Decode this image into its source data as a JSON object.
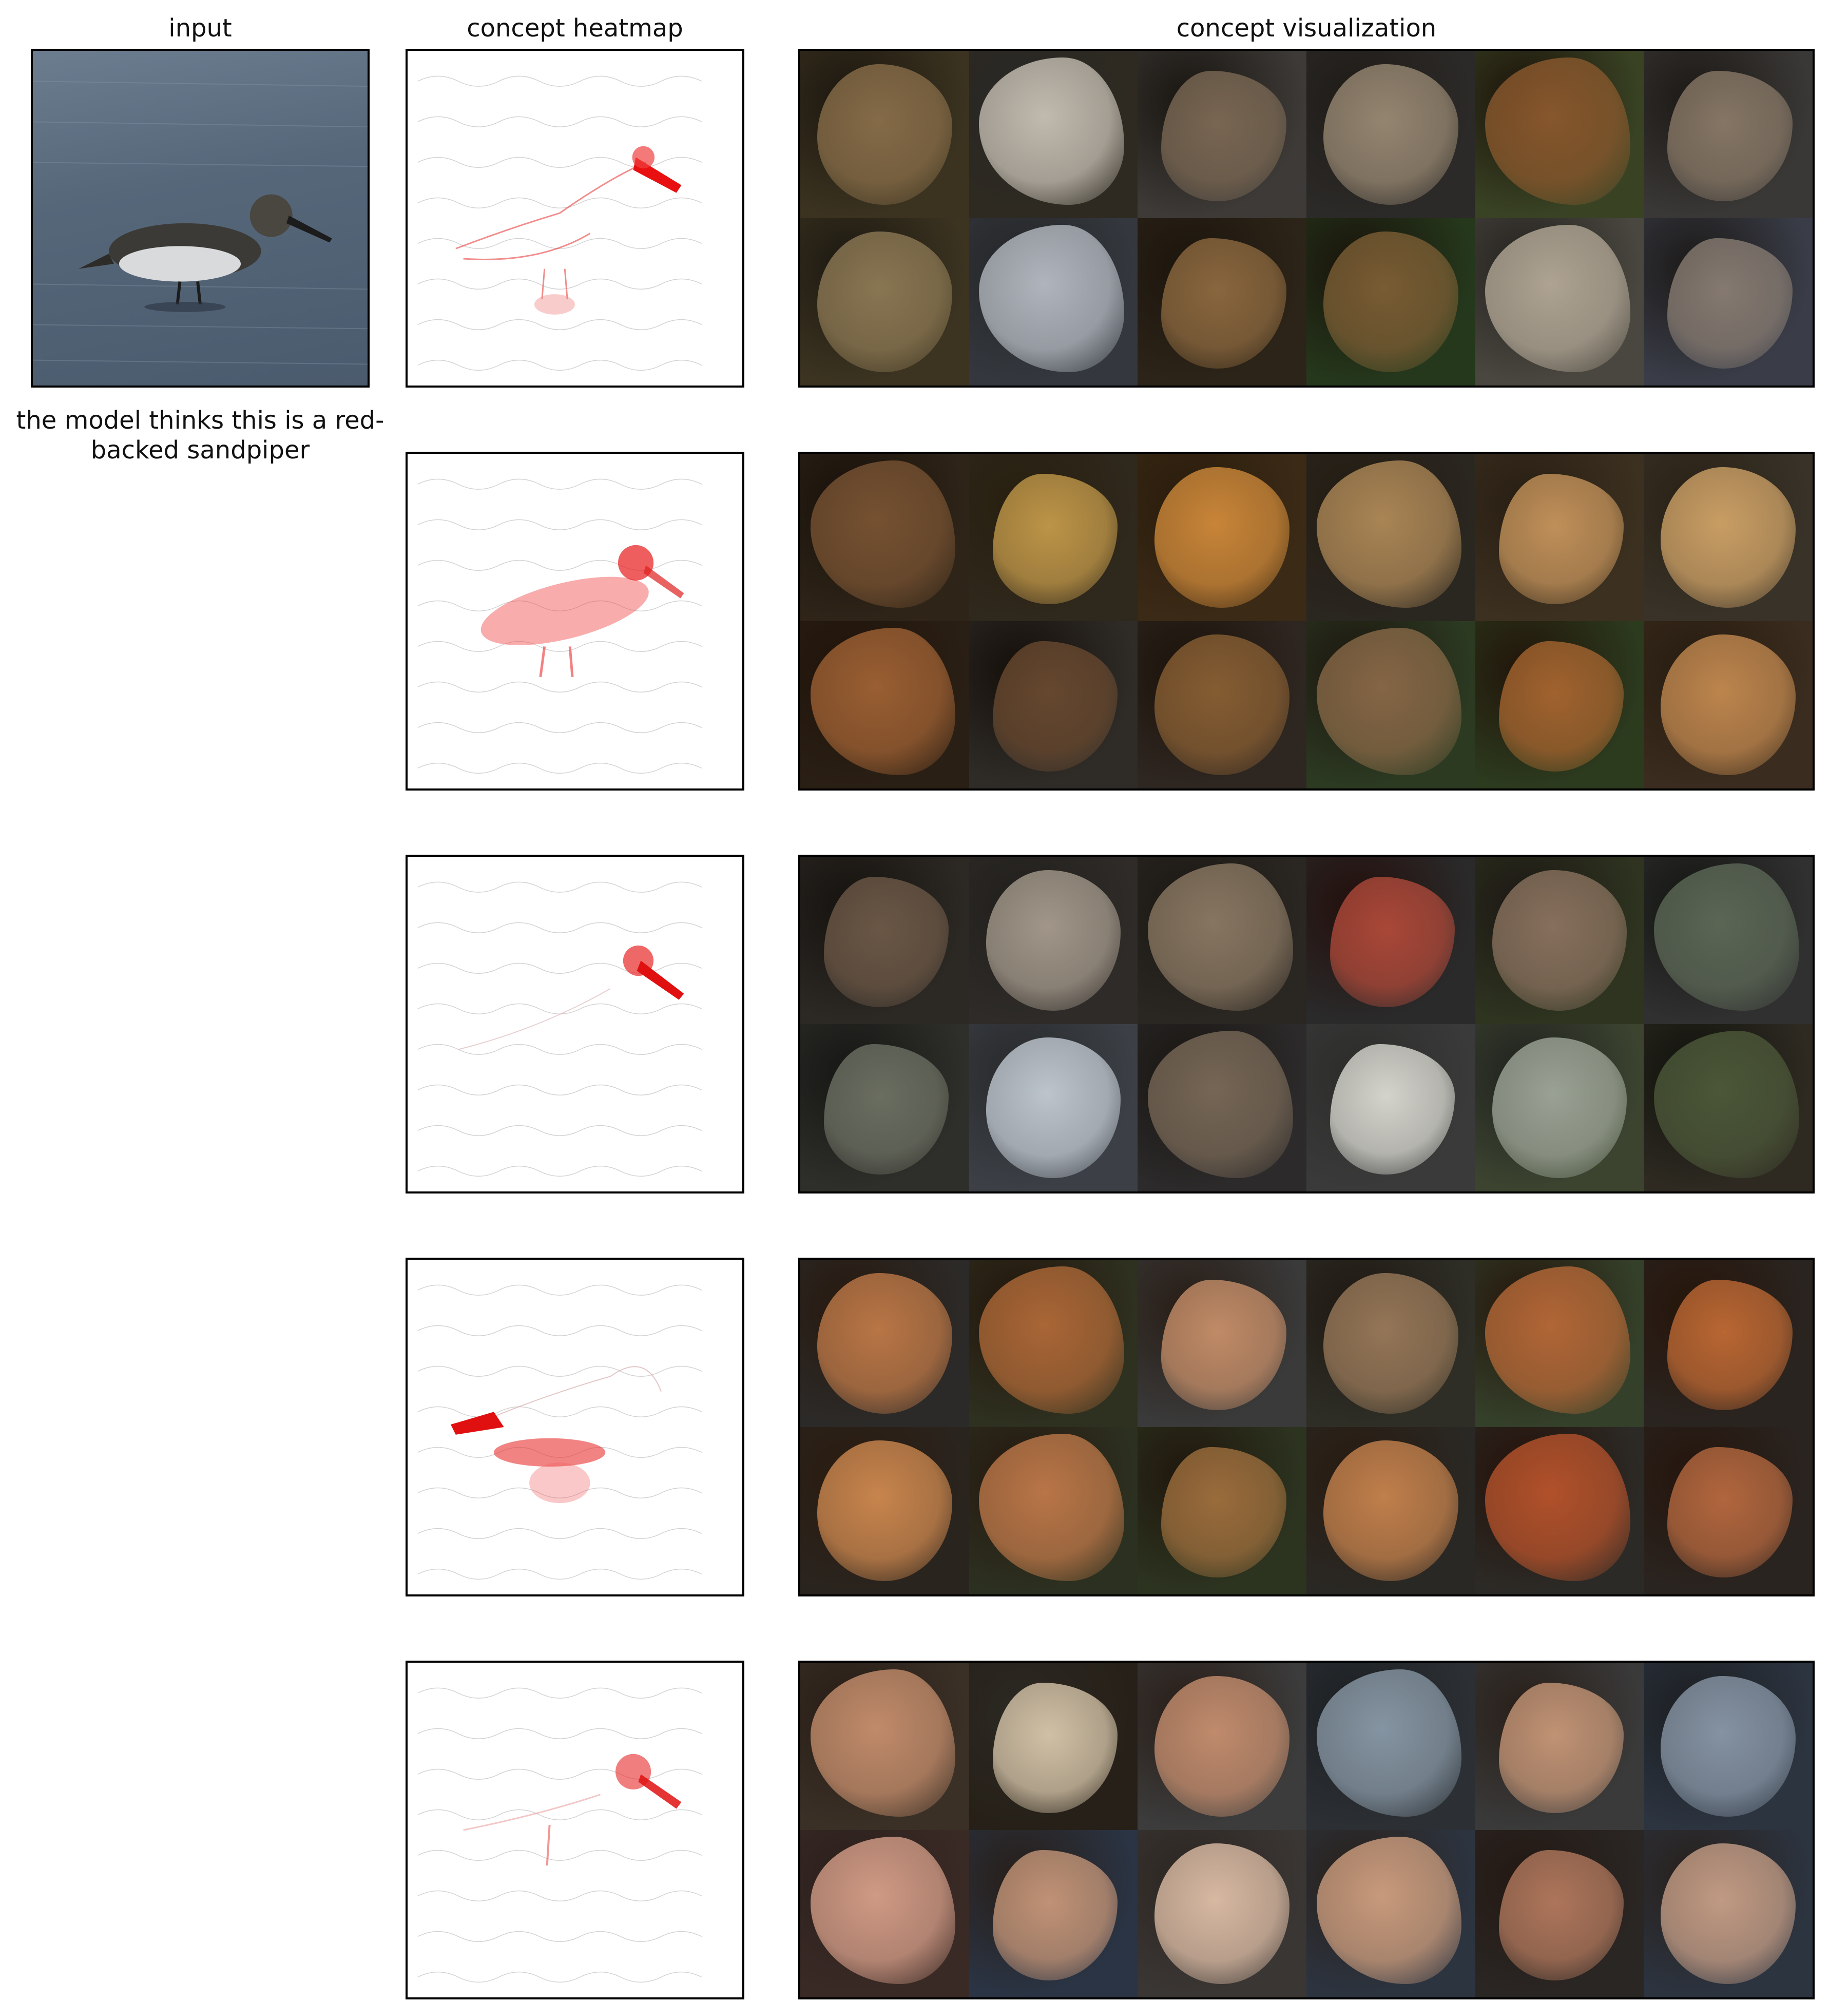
{
  "columns": {
    "input_title": "input",
    "heatmap_title": "concept heatmap",
    "visualization_title": "concept visualization"
  },
  "prediction_caption": "the model thinks this is a red-backed sandpiper",
  "concept_rows": [
    {
      "tiles": [
        {
          "bg": "#3b3320",
          "fg": "#8a6f4a"
        },
        {
          "bg": "#2e2a22",
          "fg": "#c9c2b6"
        },
        {
          "bg": "#3d3a37",
          "fg": "#7d6a55"
        },
        {
          "bg": "#2c2a28",
          "fg": "#9a8a74"
        },
        {
          "bg": "#394324",
          "fg": "#8c5a2e"
        },
        {
          "bg": "#3a3836",
          "fg": "#8a7a68"
        },
        {
          "bg": "#3c3421",
          "fg": "#8e7a55"
        },
        {
          "bg": "#34383e",
          "fg": "#b7bcc4"
        },
        {
          "bg": "#2c2418",
          "fg": "#8e6a40"
        },
        {
          "bg": "#25381c",
          "fg": "#7d5f35"
        },
        {
          "bg": "#4a4740",
          "fg": "#b5aa98"
        },
        {
          "bg": "#3a3d48",
          "fg": "#8a7e74"
        }
      ]
    },
    {
      "tiles": [
        {
          "bg": "#2e2418",
          "fg": "#7a5433"
        },
        {
          "bg": "#2f281c",
          "fg": "#c49a4a"
        },
        {
          "bg": "#3b2a16",
          "fg": "#d08a3a"
        },
        {
          "bg": "#2a2620",
          "fg": "#b08a58"
        },
        {
          "bg": "#3c3020",
          "fg": "#c7955c"
        },
        {
          "bg": "#383228",
          "fg": "#d1a468"
        },
        {
          "bg": "#2a1f14",
          "fg": "#a06234"
        },
        {
          "bg": "#2f2c28",
          "fg": "#6a4a30"
        },
        {
          "bg": "#2e2620",
          "fg": "#8a6034"
        },
        {
          "bg": "#2c3a22",
          "fg": "#8a6a48"
        },
        {
          "bg": "#2c3a1e",
          "fg": "#a76630"
        },
        {
          "bg": "#3a2c1e",
          "fg": "#c48a50"
        }
      ]
    },
    {
      "tiles": [
        {
          "bg": "#2c2824",
          "fg": "#6e5a48"
        },
        {
          "bg": "#2e2b28",
          "fg": "#a79c8e"
        },
        {
          "bg": "#2a2622",
          "fg": "#8c7a64"
        },
        {
          "bg": "#2a2a2a",
          "fg": "#b04a3a"
        },
        {
          "bg": "#2e3420",
          "fg": "#8c7460"
        },
        {
          "bg": "#303030",
          "fg": "#5e6a58"
        },
        {
          "bg": "#2e2e2a",
          "fg": "#6e7264"
        },
        {
          "bg": "#3c4046",
          "fg": "#c4ccd4"
        },
        {
          "bg": "#2c2a2a",
          "fg": "#7a6a58"
        },
        {
          "bg": "#3a3a3a",
          "fg": "#dcdcd4"
        },
        {
          "bg": "#3c4430",
          "fg": "#a0a89a"
        },
        {
          "bg": "#2e2a22",
          "fg": "#4e5a3a"
        }
      ]
    },
    {
      "tiles": [
        {
          "bg": "#2c2a28",
          "fg": "#c07a48"
        },
        {
          "bg": "#2e3020",
          "fg": "#b06a38"
        },
        {
          "bg": "#3a3a3a",
          "fg": "#c8906a"
        },
        {
          "bg": "#2e2e26",
          "fg": "#9a7a5a"
        },
        {
          "bg": "#34402a",
          "fg": "#b86a38"
        },
        {
          "bg": "#2a2420",
          "fg": "#c06a34"
        },
        {
          "bg": "#2a241e",
          "fg": "#d08a50"
        },
        {
          "bg": "#2c3020",
          "fg": "#c07a4a"
        },
        {
          "bg": "#2c3420",
          "fg": "#a0703e"
        },
        {
          "bg": "#2a2824",
          "fg": "#c8844e"
        },
        {
          "bg": "#2c2a26",
          "fg": "#b8542c"
        },
        {
          "bg": "#2a2420",
          "fg": "#b86a40"
        }
      ]
    },
    {
      "tiles": [
        {
          "bg": "#3a3026",
          "fg": "#c8906e"
        },
        {
          "bg": "#262018",
          "fg": "#d9c8ac"
        },
        {
          "bg": "#3c3c3c",
          "fg": "#c89070"
        },
        {
          "bg": "#2c3034",
          "fg": "#8a9aa8"
        },
        {
          "bg": "#3a3a3a",
          "fg": "#c89878"
        },
        {
          "bg": "#2c3440",
          "fg": "#8a98a8"
        },
        {
          "bg": "#3a2a26",
          "fg": "#d8a08a"
        },
        {
          "bg": "#2a3444",
          "fg": "#c8987a"
        },
        {
          "bg": "#3a3634",
          "fg": "#e0c0a8"
        },
        {
          "bg": "#2c3440",
          "fg": "#d0a080"
        },
        {
          "bg": "#2a2624",
          "fg": "#b47a5e"
        },
        {
          "bg": "#2c3440",
          "fg": "#c8a088"
        }
      ]
    }
  ]
}
